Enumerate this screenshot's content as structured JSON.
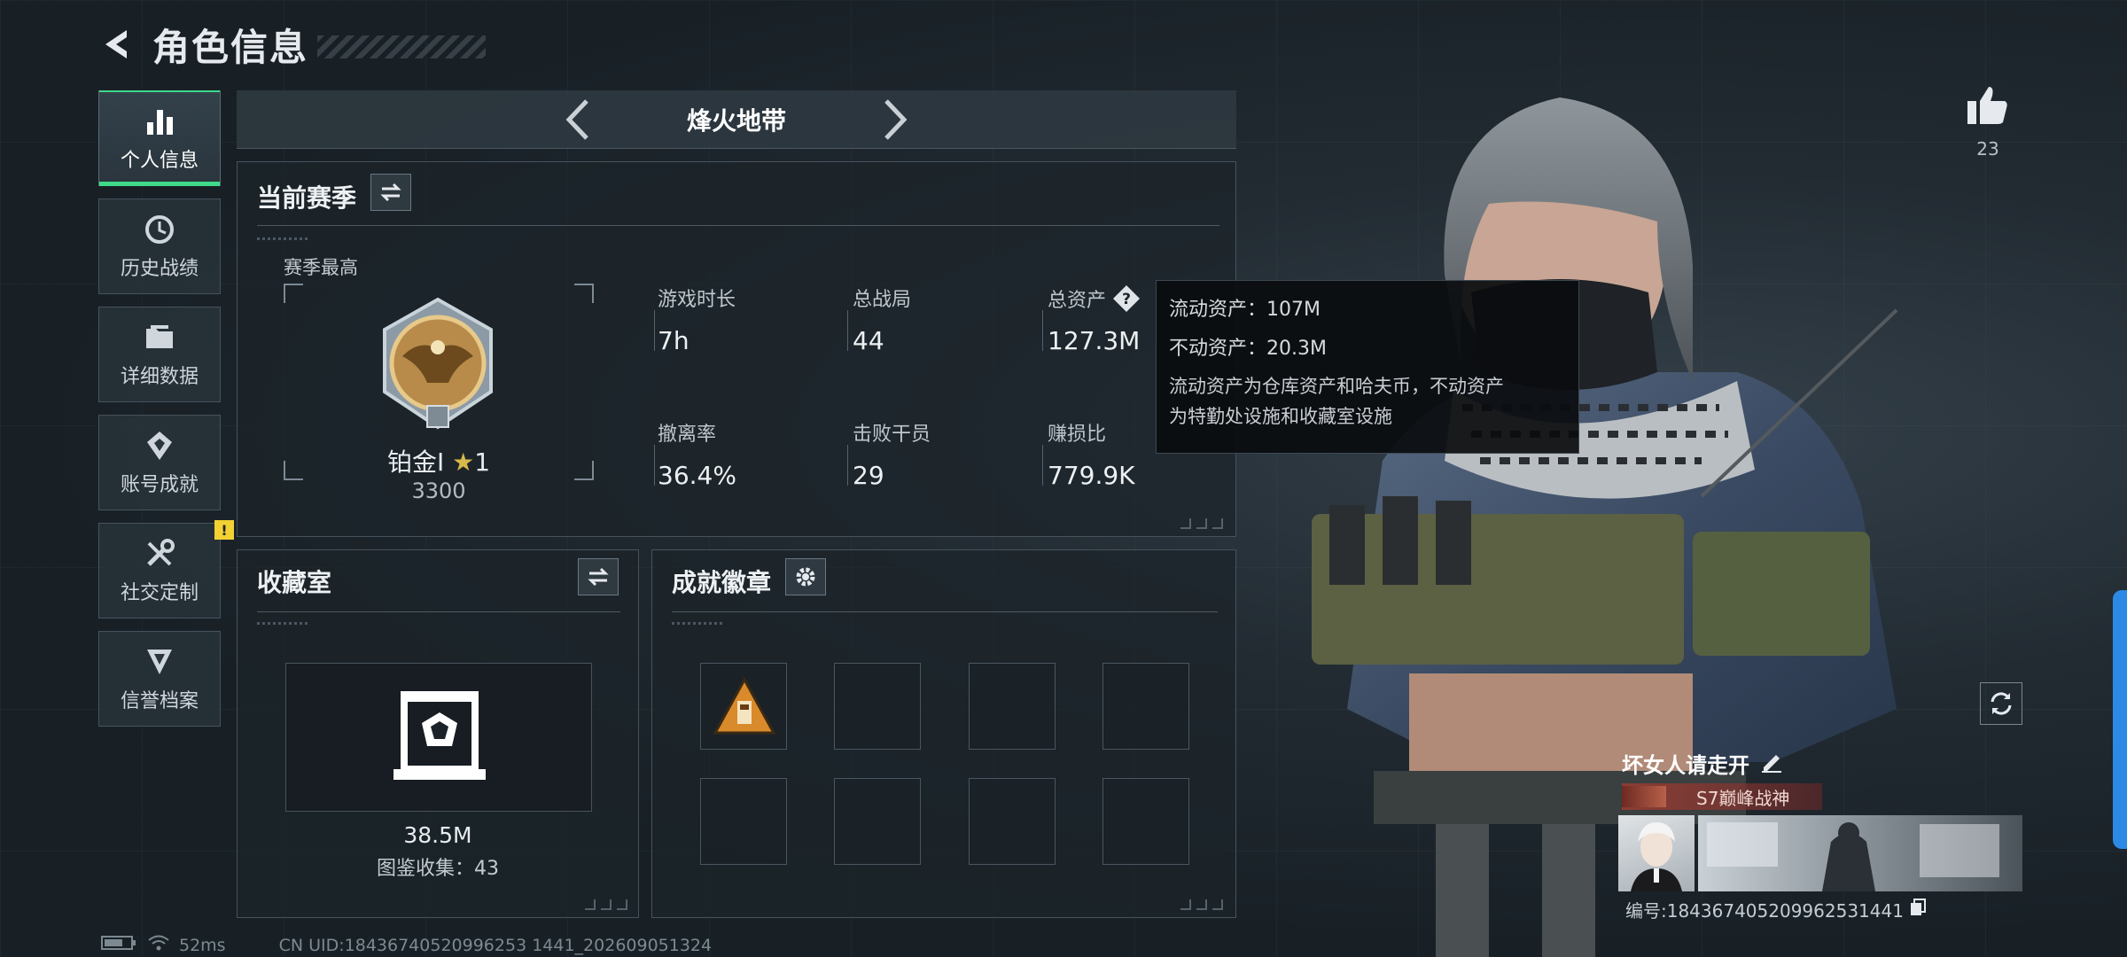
{
  "header": {
    "title": "角色信息",
    "back_icon": "back-arrow-icon"
  },
  "sidebar": {
    "items": [
      {
        "label": "个人信息",
        "icon": "bar-chart-icon",
        "active": true
      },
      {
        "label": "历史战绩",
        "icon": "history-clock-icon"
      },
      {
        "label": "详细数据",
        "icon": "folder-icon"
      },
      {
        "label": "账号成就",
        "icon": "achievement-icon"
      },
      {
        "label": "社交定制",
        "icon": "tools-icon",
        "notification": "!"
      },
      {
        "label": "信誉档案",
        "icon": "shield-icon"
      }
    ]
  },
  "mode": {
    "name": "烽火地带"
  },
  "season": {
    "title": "当前赛季",
    "best_label": "赛季最高",
    "rank_name": "铂金Ⅰ",
    "rank_stars": "1",
    "rank_score": "3300",
    "stats": [
      {
        "label": "游戏时长",
        "value": "7h"
      },
      {
        "label": "总战局",
        "value": "44"
      },
      {
        "label": "总资产",
        "value": "127.3M"
      },
      {
        "label": "撤离率",
        "value": "36.4%"
      },
      {
        "label": "击败干员",
        "value": "29"
      },
      {
        "label": "赚损比",
        "value": "779.9K"
      }
    ]
  },
  "tooltip": {
    "liquid": "流动资产：107M",
    "fixed": "不动资产：20.3M",
    "desc_line1": "流动资产为仓库资产和哈夫币，不动资产",
    "desc_line2": "为特勤处设施和收藏室设施"
  },
  "collection": {
    "title": "收藏室",
    "value": "38.5M",
    "sub": "图鉴收集：43"
  },
  "badges": {
    "title": "成就徽章",
    "slot_count": 8,
    "filled": 1
  },
  "profile": {
    "likes": "23",
    "name": "坏女人请走开",
    "title_tag": "S7巅峰战神",
    "id_label": "编号:18436740520996253144​1"
  },
  "footer": {
    "ping": "52ms",
    "uid": "CN UID:18436740520996253 1441_202609051324"
  },
  "colors": {
    "accent": "#3fd98a",
    "notification": "#f2d233",
    "edge_tab": "#2c8ae6"
  }
}
